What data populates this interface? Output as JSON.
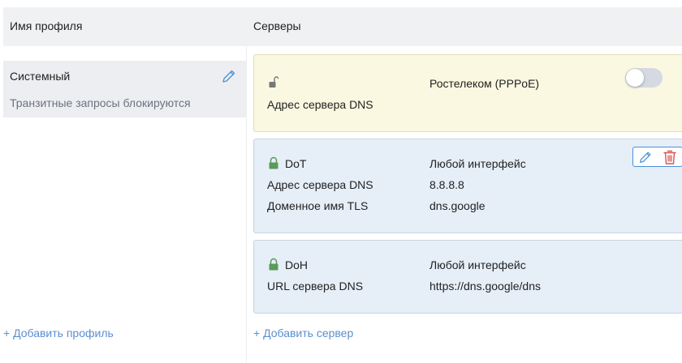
{
  "header": {
    "profile_col": "Имя профиля",
    "servers_col": "Серверы"
  },
  "profiles": [
    {
      "name": "Системный",
      "description": "Транзитные запросы блокируются"
    }
  ],
  "add_profile_label": "+ Добавить профиль",
  "add_server_label": "+ Добавить сервер",
  "servers": {
    "system": {
      "interface": "Ростелеком (PPPoE)",
      "dns_label": "Адрес сервера DNS",
      "enabled": false,
      "lock_icon": "unlocked-icon"
    },
    "dot": {
      "protocol": "DoT",
      "interface": "Любой интерфейс",
      "dns_label": "Адрес сервера DNS",
      "dns_value": "8.8.8.8",
      "tls_label": "Доменное имя TLS",
      "tls_value": "dns.google",
      "lock_icon": "lock-icon"
    },
    "doh": {
      "protocol": "DoH",
      "interface": "Любой интерфейс",
      "url_label": "URL сервера DNS",
      "url_value": "https://dns.google/dns",
      "lock_icon": "lock-icon"
    }
  },
  "colors": {
    "accent": "#4a90d9",
    "link": "#5b8fd0",
    "delete": "#d9534f",
    "lock_green": "#5a9a5a",
    "system_card_bg": "#fbf8e1",
    "server_card_bg": "#e6eef8"
  }
}
